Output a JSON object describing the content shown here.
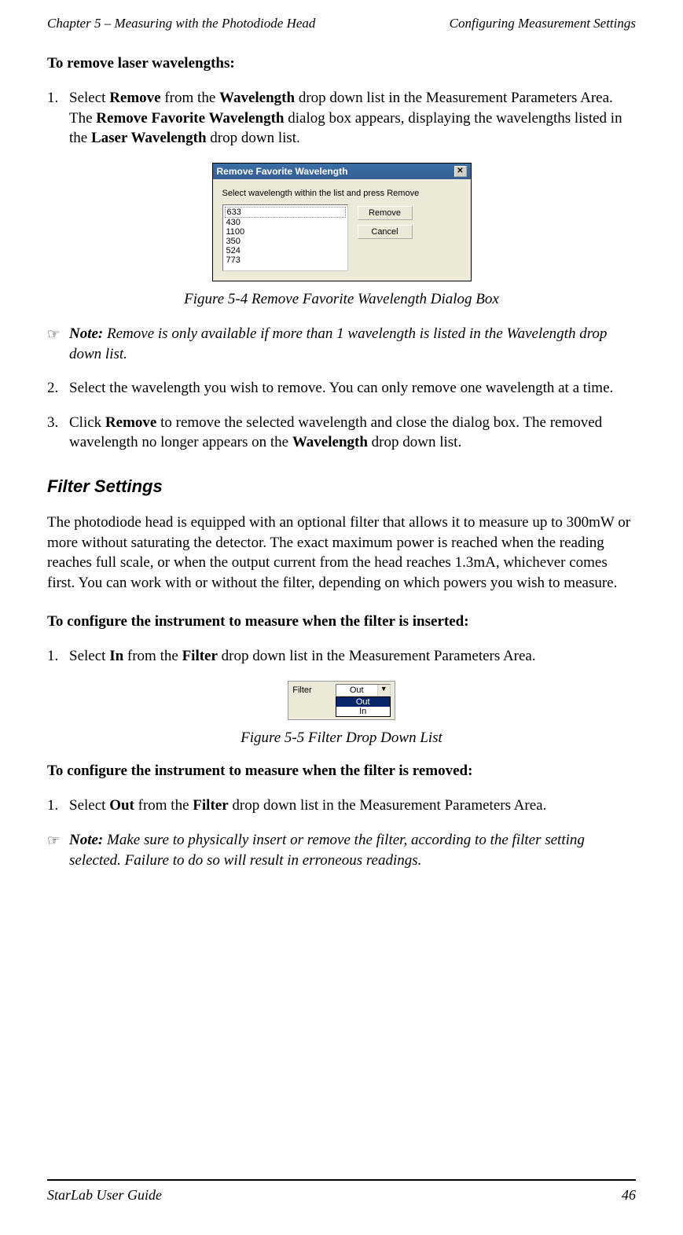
{
  "header": {
    "left": "Chapter 5 – Measuring with the Photodiode Head",
    "right": "Configuring Measurement Settings"
  },
  "remove_section": {
    "lead": "To remove laser wavelengths:",
    "step1_pre": "Select ",
    "step1_b1": "Remove",
    "step1_mid1": " from the ",
    "step1_b2": "Wavelength",
    "step1_mid2": " drop down list in the Measurement Parameters Area. The ",
    "step1_b3": "Remove Favorite Wavelength",
    "step1_mid3": " dialog box appears, displaying the wavelengths listed in the ",
    "step1_b4": "Laser Wavelength",
    "step1_end": " drop down list."
  },
  "dialog": {
    "title": "Remove Favorite Wavelength",
    "prompt": "Select wavelength within the list and press Remove",
    "items": [
      "633",
      "430",
      "1100",
      "350",
      "524",
      "773"
    ],
    "btn_remove": "Remove",
    "btn_cancel": "Cancel"
  },
  "figure54": "Figure 5-4 Remove Favorite Wavelength Dialog Box",
  "note1": {
    "label": "Note:",
    "text": " Remove is only available if more than 1 wavelength is listed in the Wavelength drop down list."
  },
  "step2": "Select the wavelength you wish to remove. You can only remove one wavelength at a time.",
  "step3": {
    "pre": "Click ",
    "b1": "Remove",
    "mid": " to remove the selected wavelength and close the dialog box. The removed wavelength no longer appears on the ",
    "b2": "Wavelength",
    "end": " drop down list."
  },
  "filter_section": {
    "heading": "Filter Settings",
    "para": "The photodiode head is equipped with an optional filter that allows it to measure up to 300mW or more without saturating the detector. The exact maximum power is reached when the reading reaches full scale, or when the output current from the head reaches 1.3mA, whichever comes first. You can work with or without the filter, depending on which powers you wish to measure.",
    "lead_inserted": "To configure the instrument to measure when the filter is inserted:",
    "step_in_pre": "Select ",
    "step_in_b1": "In",
    "step_in_mid": " from the ",
    "step_in_b2": "Filter",
    "step_in_end": " drop down list in the Measurement Parameters Area."
  },
  "filter_widget": {
    "label": "Filter",
    "selected": "Out",
    "options": [
      "Out",
      "In"
    ]
  },
  "figure55": "Figure 5-5 Filter Drop Down List",
  "filter_removed": {
    "lead": "To configure the instrument to measure when the filter is removed:",
    "pre": "Select ",
    "b1": "Out",
    "mid": " from the ",
    "b2": "Filter",
    "end": " drop down list in the Measurement Parameters Area."
  },
  "note2": {
    "label": "Note:",
    "text": " Make sure to physically insert or remove the filter, according to the filter setting selected. Failure to do so will result in erroneous readings."
  },
  "footer": {
    "left": "StarLab User Guide",
    "right": "46"
  }
}
